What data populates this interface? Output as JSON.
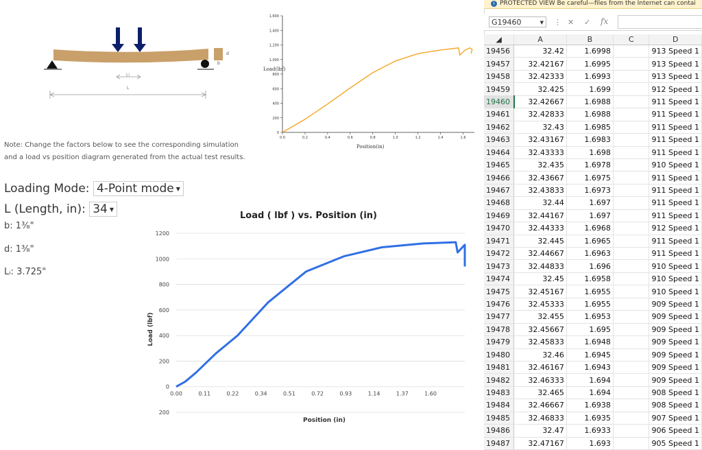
{
  "left_panel": {
    "note_line1": "Note: Change the factors below to see the corresponding simulation",
    "note_line2": "and a load vs position diagram generated from the actual test results.",
    "loading_mode_label": "Loading Mode:",
    "loading_mode_value": "4-Point mode",
    "length_label": "L (Length, in):",
    "length_value": "34",
    "b_label": "b: 1³⁄₈\"",
    "d_label": "d: 1³⁄₈\"",
    "li_label": "Lᵢ: 3.725\"",
    "beam_labels": {
      "d": "d",
      "b": "b",
      "li": "Li",
      "L": "L"
    }
  },
  "small_chart": {
    "ylabel": "Load(lbf)",
    "xlabel": "Position(in)",
    "y_ticks": [
      "1,600",
      "1,400",
      "1,200",
      "1,000",
      "800",
      "600",
      "400",
      "200",
      "0"
    ],
    "x_ticks": [
      "0.0",
      "0.2",
      "0.4",
      "0.6",
      "0.8",
      "1.0",
      "1.2",
      "1.4",
      "1.6"
    ]
  },
  "main_chart": {
    "title": "Load ( lbf ) vs. Position (in)",
    "ylabel": "Load (lbf)",
    "xlabel": "Position (in)",
    "y_ticks": [
      "1200",
      "1000",
      "800",
      "600",
      "400",
      "200",
      "0",
      "200"
    ],
    "x_ticks": [
      "0.00",
      "0.11",
      "0.22",
      "0.34",
      "0.51",
      "0.72",
      "0.93",
      "1.14",
      "1.37",
      "1.60"
    ]
  },
  "chart_data": [
    {
      "type": "line",
      "title": "",
      "xlabel": "Position(in)",
      "ylabel": "Load(lbf)",
      "xlim": [
        0,
        1.7
      ],
      "ylim": [
        0,
        1600
      ],
      "series": [
        {
          "color": "#f5a623",
          "x": [
            0.0,
            0.2,
            0.4,
            0.6,
            0.8,
            1.0,
            1.2,
            1.4,
            1.56,
            1.57,
            1.62,
            1.66,
            1.68,
            1.67
          ],
          "y": [
            0,
            180,
            390,
            610,
            820,
            980,
            1080,
            1130,
            1160,
            1060,
            1130,
            1160,
            1140,
            1080
          ]
        }
      ]
    },
    {
      "type": "line",
      "title": "Load ( lbf ) vs. Position (in)",
      "xlabel": "Position (in)",
      "ylabel": "Load (lbf)",
      "xlim": [
        0,
        1.6
      ],
      "ylim": [
        -200,
        1200
      ],
      "series": [
        {
          "color": "#2f6fe4",
          "x": [
            0.0,
            0.05,
            0.11,
            0.22,
            0.34,
            0.51,
            0.72,
            0.93,
            1.14,
            1.37,
            1.55,
            1.56,
            1.6,
            1.6
          ],
          "y": [
            0,
            40,
            110,
            260,
            400,
            660,
            900,
            1020,
            1090,
            1120,
            1130,
            1050,
            1110,
            940
          ]
        }
      ]
    }
  ],
  "excel": {
    "protected_view": "PROTECTED VIEW  Be careful—files from the Internet can contai",
    "namebox": "G19460",
    "fx": "fx",
    "cancel": "✕",
    "enter": "✓",
    "columns": [
      "A",
      "B",
      "C",
      "D"
    ],
    "rows": [
      {
        "n": "19456",
        "a": "32.42",
        "b": "1.6998",
        "d": "913 Speed 1"
      },
      {
        "n": "19457",
        "a": "32.42167",
        "b": "1.6995",
        "d": "913 Speed 1"
      },
      {
        "n": "19458",
        "a": "32.42333",
        "b": "1.6993",
        "d": "913 Speed 1"
      },
      {
        "n": "19459",
        "a": "32.425",
        "b": "1.699",
        "d": "912 Speed 1"
      },
      {
        "n": "19460",
        "a": "32.42667",
        "b": "1.6988",
        "d": "911 Speed 1"
      },
      {
        "n": "19461",
        "a": "32.42833",
        "b": "1.6988",
        "d": "911 Speed 1"
      },
      {
        "n": "19462",
        "a": "32.43",
        "b": "1.6985",
        "d": "911 Speed 1"
      },
      {
        "n": "19463",
        "a": "32.43167",
        "b": "1.6983",
        "d": "911 Speed 1"
      },
      {
        "n": "19464",
        "a": "32.43333",
        "b": "1.698",
        "d": "911 Speed 1"
      },
      {
        "n": "19465",
        "a": "32.435",
        "b": "1.6978",
        "d": "910 Speed 1"
      },
      {
        "n": "19466",
        "a": "32.43667",
        "b": "1.6975",
        "d": "911 Speed 1"
      },
      {
        "n": "19467",
        "a": "32.43833",
        "b": "1.6973",
        "d": "911 Speed 1"
      },
      {
        "n": "19468",
        "a": "32.44",
        "b": "1.697",
        "d": "911 Speed 1"
      },
      {
        "n": "19469",
        "a": "32.44167",
        "b": "1.697",
        "d": "911 Speed 1"
      },
      {
        "n": "19470",
        "a": "32.44333",
        "b": "1.6968",
        "d": "912 Speed 1"
      },
      {
        "n": "19471",
        "a": "32.445",
        "b": "1.6965",
        "d": "911 Speed 1"
      },
      {
        "n": "19472",
        "a": "32.44667",
        "b": "1.6963",
        "d": "911 Speed 1"
      },
      {
        "n": "19473",
        "a": "32.44833",
        "b": "1.696",
        "d": "910 Speed 1"
      },
      {
        "n": "19474",
        "a": "32.45",
        "b": "1.6958",
        "d": "910 Speed 1"
      },
      {
        "n": "19475",
        "a": "32.45167",
        "b": "1.6955",
        "d": "910 Speed 1"
      },
      {
        "n": "19476",
        "a": "32.45333",
        "b": "1.6955",
        "d": "909 Speed 1"
      },
      {
        "n": "19477",
        "a": "32.455",
        "b": "1.6953",
        "d": "909 Speed 1"
      },
      {
        "n": "19478",
        "a": "32.45667",
        "b": "1.695",
        "d": "909 Speed 1"
      },
      {
        "n": "19479",
        "a": "32.45833",
        "b": "1.6948",
        "d": "909 Speed 1"
      },
      {
        "n": "19480",
        "a": "32.46",
        "b": "1.6945",
        "d": "909 Speed 1"
      },
      {
        "n": "19481",
        "a": "32.46167",
        "b": "1.6943",
        "d": "909 Speed 1"
      },
      {
        "n": "19482",
        "a": "32.46333",
        "b": "1.694",
        "d": "909 Speed 1"
      },
      {
        "n": "19483",
        "a": "32.465",
        "b": "1.694",
        "d": "908 Speed 1"
      },
      {
        "n": "19484",
        "a": "32.46667",
        "b": "1.6938",
        "d": "908 Speed 1"
      },
      {
        "n": "19485",
        "a": "32.46833",
        "b": "1.6935",
        "d": "907 Speed 1"
      },
      {
        "n": "19486",
        "a": "32.47",
        "b": "1.6933",
        "d": "906 Speed 1"
      },
      {
        "n": "19487",
        "a": "32.47167",
        "b": "1.693",
        "d": "905 Speed 1"
      }
    ],
    "active_row": "19460"
  }
}
